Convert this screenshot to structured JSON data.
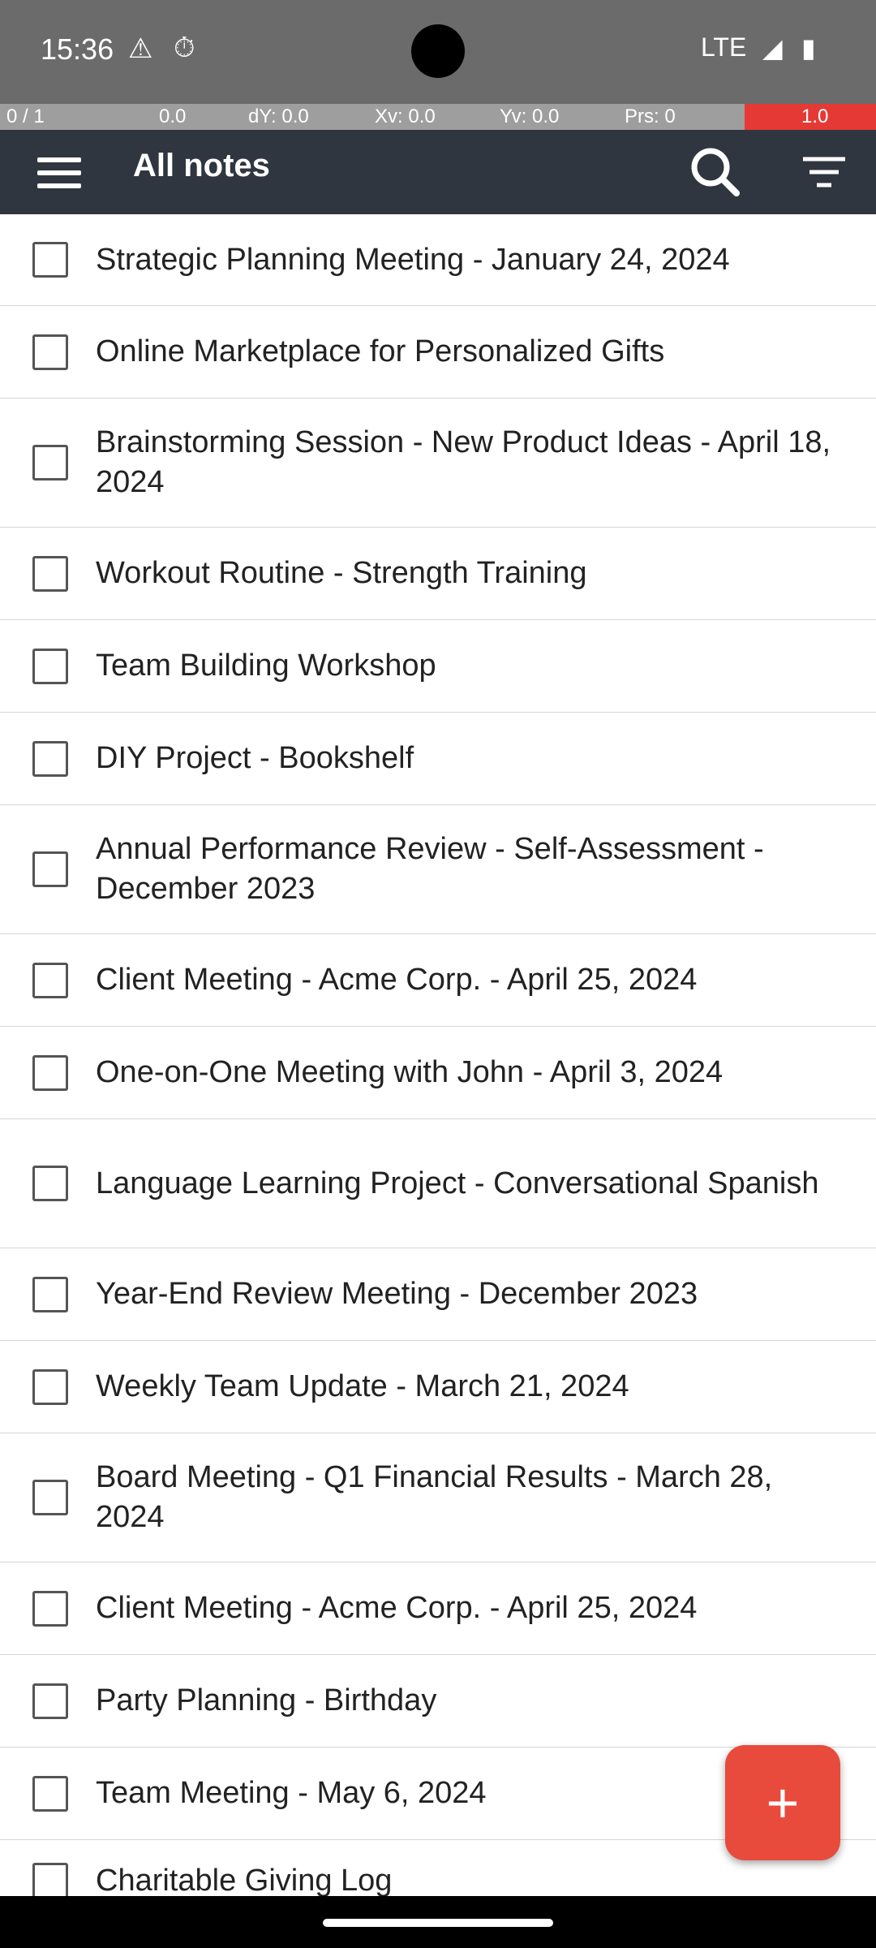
{
  "status": {
    "time": "15:36",
    "network": "LTE"
  },
  "debug": {
    "pointer": "0 / 1",
    "dx": "0.0",
    "dy": "dY: 0.0",
    "xv": "Xv: 0.0",
    "yv": "Yv: 0.0",
    "prs": "Prs: 0",
    "size": "1.0"
  },
  "toolbar": {
    "title": "All notes"
  },
  "notes": [
    {
      "title": "Strategic Planning Meeting - January 24, 2024"
    },
    {
      "title": "Online Marketplace for Personalized Gifts"
    },
    {
      "title": "Brainstorming Session - New Product Ideas - April 18, 2024"
    },
    {
      "title": "Workout Routine - Strength Training"
    },
    {
      "title": "Team Building Workshop"
    },
    {
      "title": "DIY Project - Bookshelf"
    },
    {
      "title": "Annual Performance Review - Self-Assessment - December 2023"
    },
    {
      "title": "Client Meeting - Acme Corp. - April 25, 2024"
    },
    {
      "title": "One-on-One Meeting with John - April 3, 2024"
    },
    {
      "title": "Language Learning Project - Conversational Spanish"
    },
    {
      "title": "Year-End Review Meeting - December 2023"
    },
    {
      "title": "Weekly Team Update - March 21, 2024"
    },
    {
      "title": "Board Meeting - Q1 Financial Results - March 28, 2024"
    },
    {
      "title": "Client Meeting - Acme Corp. - April 25, 2024"
    },
    {
      "title": "Party Planning - Birthday"
    },
    {
      "title": "Team Meeting - May 6, 2024"
    },
    {
      "title": "Charitable Giving Log"
    }
  ],
  "fab": {
    "symbol": "+"
  },
  "colors": {
    "toolbar": "#2f3640",
    "fab": "#e84a3c"
  }
}
